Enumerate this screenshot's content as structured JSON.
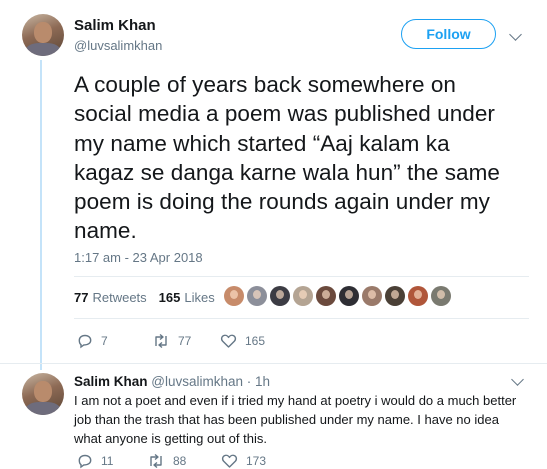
{
  "tweet": {
    "author_name": "Salim Khan",
    "author_handle": "@luvsalimkhan",
    "follow_label": "Follow",
    "text": "A couple of years back somewhere on social media a poem was published under my name which started “Aaj kalam ka kagaz se danga karne wala hun” the same poem is doing the rounds again under my name.",
    "timestamp": "1:17 am - 23 Apr 2018",
    "retweets_count": "77",
    "retweets_label": "Retweets",
    "likes_count": "165",
    "likes_label": "Likes",
    "actions": {
      "reply_count": "7",
      "retweet_count": "77",
      "like_count": "165"
    }
  },
  "liker_colors": [
    "#c78b6a",
    "#8c8f9a",
    "#3c3c44",
    "#b4a493",
    "#6b4a3d",
    "#2e2e34",
    "#9a7a6a",
    "#4a4036",
    "#b0563a",
    "#7a7a70"
  ],
  "reply": {
    "author_name": "Salim Khan",
    "meta": "@luvsalimkhan · 1h",
    "text": "I am not a poet and even if i tried my hand at poetry i would do a much better job than the trash that has been published under my name. I have no idea what anyone is getting out of this.",
    "actions": {
      "reply_count": "11",
      "retweet_count": "88",
      "like_count": "173"
    }
  },
  "colors": {
    "accent": "#1da1f2",
    "secondary_text": "#657786",
    "thread_line": "#c4e3f9"
  }
}
